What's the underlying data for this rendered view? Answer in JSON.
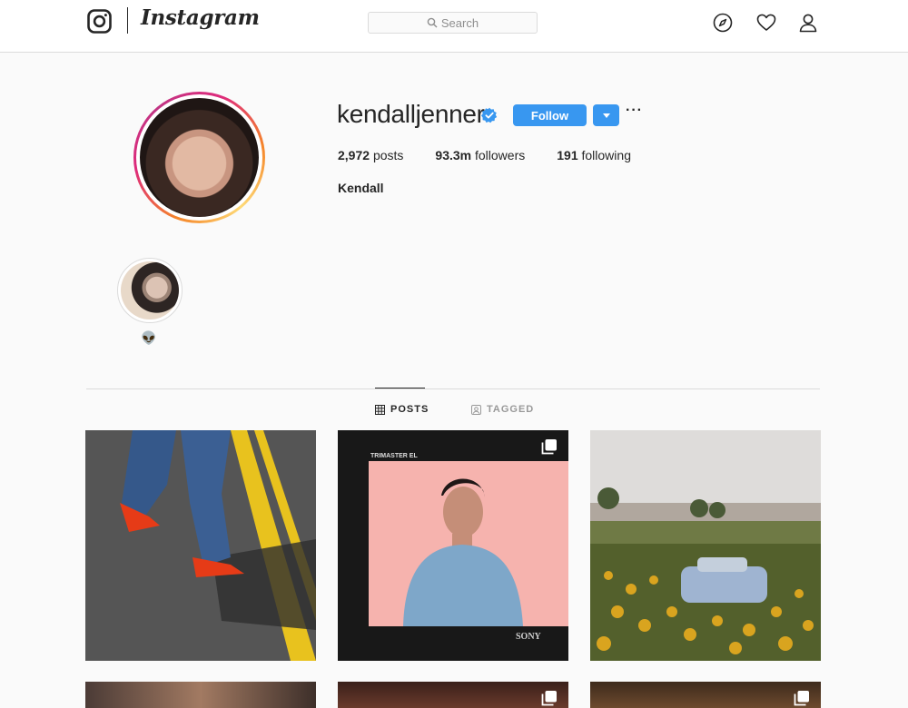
{
  "header": {
    "wordmark": "Instagram",
    "search_placeholder": "Search"
  },
  "profile": {
    "username": "kendalljenner",
    "follow_label": "Follow",
    "more_label": "···",
    "stats": {
      "posts_count": "2,972",
      "posts_label": "posts",
      "followers_count": "93.3m",
      "followers_label": "followers",
      "following_count": "191",
      "following_label": "following"
    },
    "full_name": "Kendall"
  },
  "highlights": [
    {
      "label": "👽"
    }
  ],
  "tabs": [
    {
      "label": "POSTS",
      "active": true
    },
    {
      "label": "TAGGED",
      "active": false
    }
  ],
  "colors": {
    "accent": "#3897f0",
    "verified": "#3897f0",
    "border": "#dbdbdb",
    "text": "#262626",
    "muted": "#8e8e8e"
  },
  "icons": {
    "logo": "instagram-camera-icon",
    "search": "magnifier-icon",
    "explore": "compass-icon",
    "activity": "heart-icon",
    "profile": "person-icon",
    "verified": "verified-badge-icon",
    "posts_tab": "grid-icon",
    "tagged_tab": "tag-icon",
    "multi_post": "carousel-icon"
  }
}
